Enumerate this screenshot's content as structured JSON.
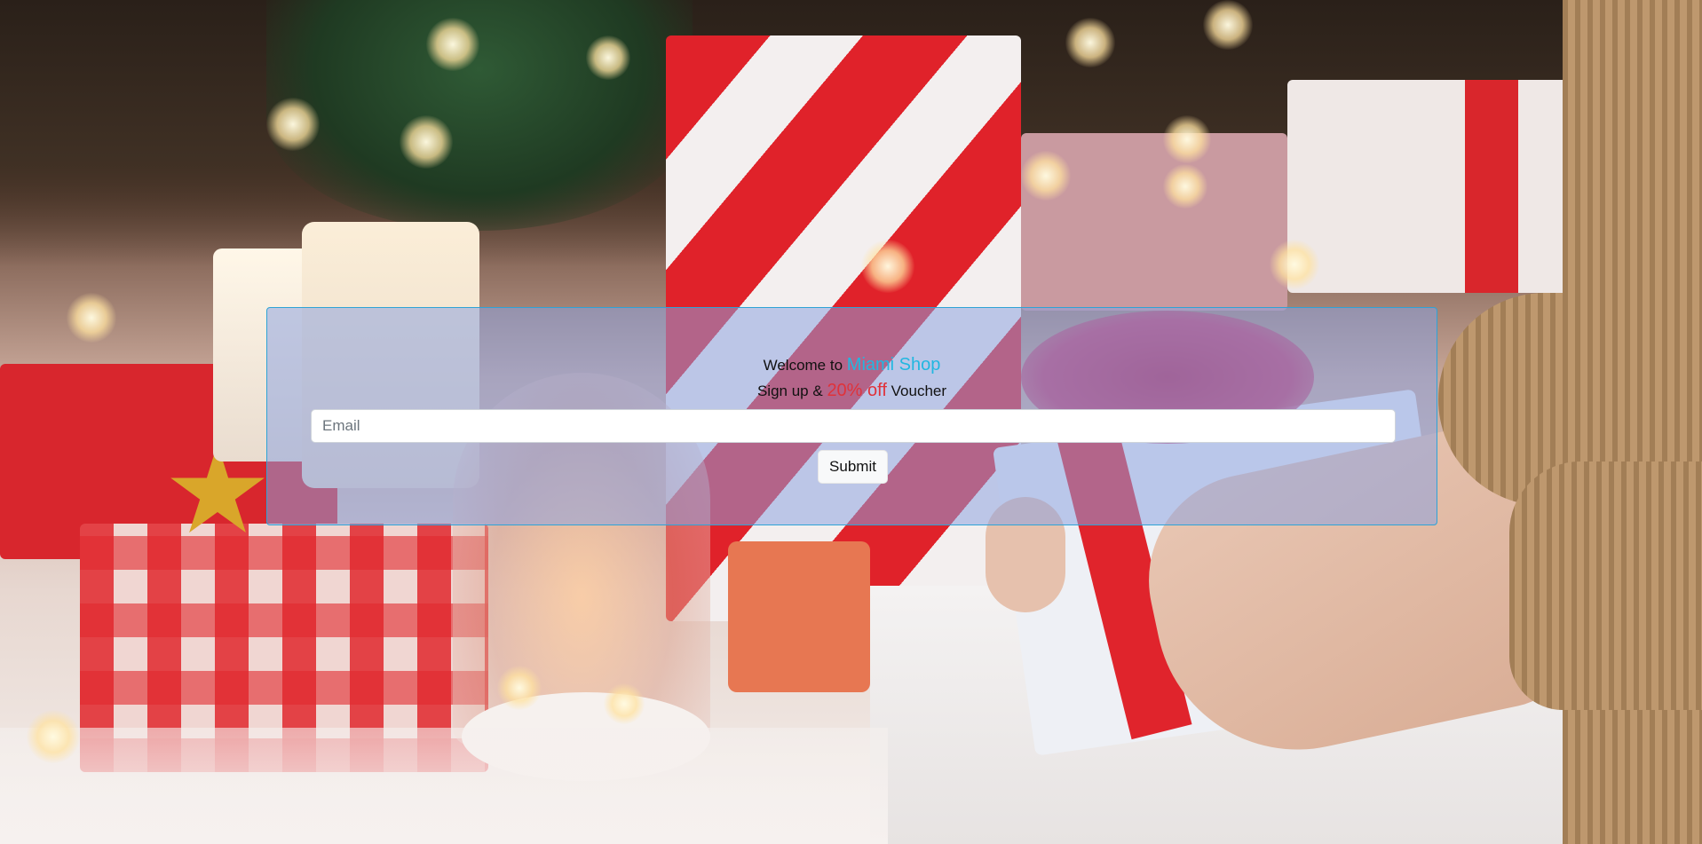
{
  "background": {
    "image": "christmas-gift-photo",
    "colors": {
      "gift_red": "#e0222a",
      "ribbon_pink": "#c42a58",
      "sweater_tan": "#b88f62"
    }
  },
  "signup": {
    "welcome_prefix": "Welcome to",
    "brand_name": "Miami Shop",
    "signup_prefix": "Sign up &",
    "discount": "20% off",
    "signup_suffix": "Voucher",
    "email_placeholder": "Email",
    "email_value": "",
    "submit_label": "Submit"
  },
  "colors": {
    "brand": "#22b7e0",
    "discount": "#e0323a",
    "panel_border": "#2ea3d6",
    "panel_fill": "rgba(138,162,225,0.52)"
  }
}
